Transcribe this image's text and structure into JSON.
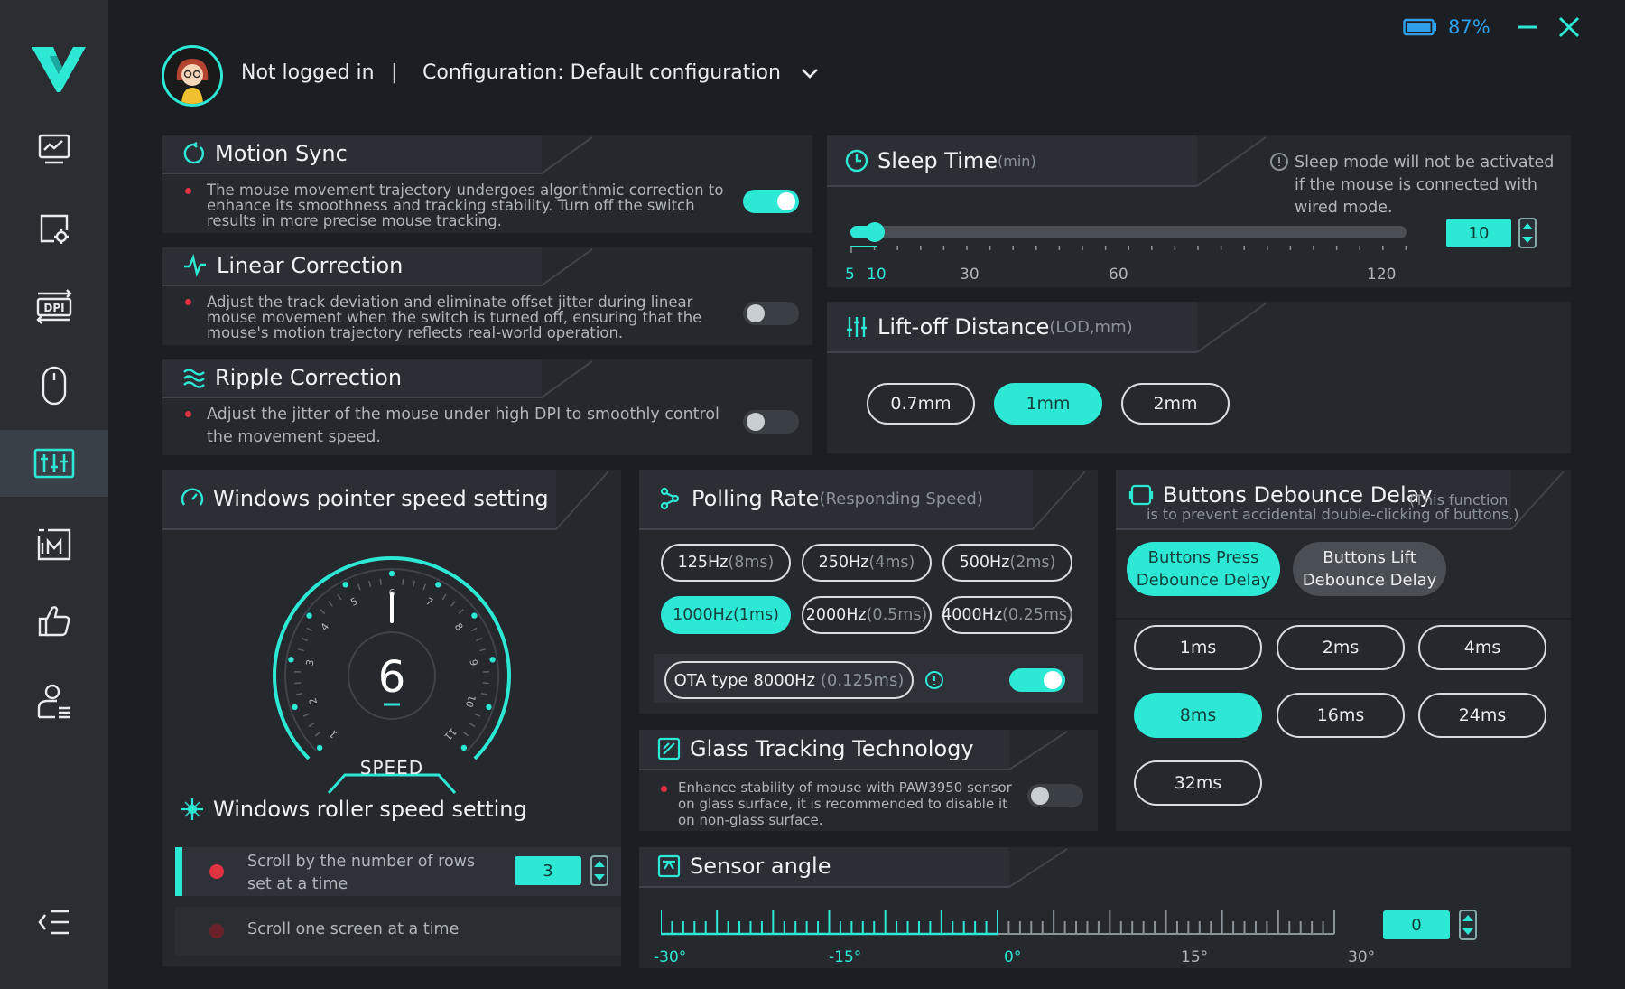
{
  "header": {
    "user_status": "Not logged in",
    "separator": "|",
    "configuration_label": "Configuration: Default configuration",
    "battery_percent": "87%"
  },
  "sidebar": {
    "items": [
      {
        "icon": "performance-chart-icon",
        "active": false
      },
      {
        "icon": "screen-settings-icon",
        "active": false
      },
      {
        "icon": "dpi-icon",
        "active": false
      },
      {
        "icon": "mouse-icon",
        "active": false
      },
      {
        "icon": "equalizer-icon",
        "active": true
      },
      {
        "icon": "macro-icon",
        "active": false
      },
      {
        "icon": "thumbs-up-icon",
        "active": false
      },
      {
        "icon": "user-settings-icon",
        "active": false
      }
    ],
    "collapse_icon": "collapse-menu-icon"
  },
  "motion_sync": {
    "title": "Motion Sync",
    "description": "The mouse movement trajectory undergoes algorithmic correction to enhance its smoothness and tracking stability. Turn off the switch results in more precise mouse tracking.",
    "enabled": true
  },
  "linear_correction": {
    "title": "Linear Correction",
    "description": "Adjust the track deviation and eliminate offset jitter during linear mouse movement when the switch is turned off, ensuring that the mouse's motion trajectory reflects real-world operation.",
    "enabled": false
  },
  "ripple_correction": {
    "title": "Ripple Correction",
    "description": "Adjust the jitter of the mouse under high DPI to smoothly control the movement speed.",
    "enabled": false
  },
  "sleep_time": {
    "title": "Sleep Time",
    "unit": "(min)",
    "note": "Sleep mode will not be activated if the mouse is connected with wired mode.",
    "value": "10",
    "labels": [
      "5",
      "10",
      "30",
      "60",
      "120"
    ]
  },
  "lift_off": {
    "title": "Lift-off Distance",
    "unit": "(LOD,mm)",
    "options": [
      "0.7mm",
      "1mm",
      "2mm"
    ],
    "selected": "1mm"
  },
  "pointer_speed": {
    "title": "Windows pointer speed setting",
    "value": "6",
    "gauge_label": "SPEED",
    "ticks": [
      "1",
      "2",
      "3",
      "4",
      "5",
      "6",
      "7",
      "8",
      "9",
      "10",
      "11"
    ]
  },
  "roller_speed": {
    "title": "Windows roller speed setting",
    "option_rows": "Scroll by the number of rows set at a time",
    "rows_value": "3",
    "option_screen": "Scroll one screen at a time"
  },
  "polling_rate": {
    "title": "Polling Rate",
    "subtitle": "(Responding Speed)",
    "options": [
      {
        "hz": "125Hz",
        "ms": "(8ms)"
      },
      {
        "hz": "250Hz",
        "ms": "(4ms)"
      },
      {
        "hz": "500Hz",
        "ms": "(2ms)"
      },
      {
        "hz": "1000Hz",
        "ms": "(1ms)"
      },
      {
        "hz": "2000Hz",
        "ms": "(0.5ms)"
      },
      {
        "hz": "4000Hz",
        "ms": "(0.25ms)"
      }
    ],
    "selected": "1000Hz",
    "ota_label": "OTA type 8000Hz",
    "ota_ms": "(0.125ms)",
    "ota_enabled": true
  },
  "glass_tracking": {
    "title": "Glass Tracking Technology",
    "description": "Enhance stability of mouse with PAW3950 sensor on glass surface, it is recommended to disable it on non-glass surface.",
    "enabled": false
  },
  "debounce": {
    "title": "Buttons Debounce Delay",
    "note_line1": "(This function",
    "note_line2": "is to prevent accidental double-clicking of buttons.)",
    "tab_press": "Buttons Press Debounce Delay",
    "tab_lift": "Buttons Lift Debounce Delay",
    "options": [
      "1ms",
      "2ms",
      "4ms",
      "8ms",
      "16ms",
      "24ms",
      "32ms"
    ],
    "selected": "8ms"
  },
  "sensor_angle": {
    "title": "Sensor angle",
    "value": "0",
    "labels": [
      "-30°",
      "-15°",
      "0°",
      "15°",
      "30°"
    ]
  },
  "colors": {
    "accent": "#2ee8d6",
    "panel": "#25282d",
    "background": "#1b1e23",
    "sidebar": "#2a2e33",
    "alert_dot": "#e0333f"
  }
}
